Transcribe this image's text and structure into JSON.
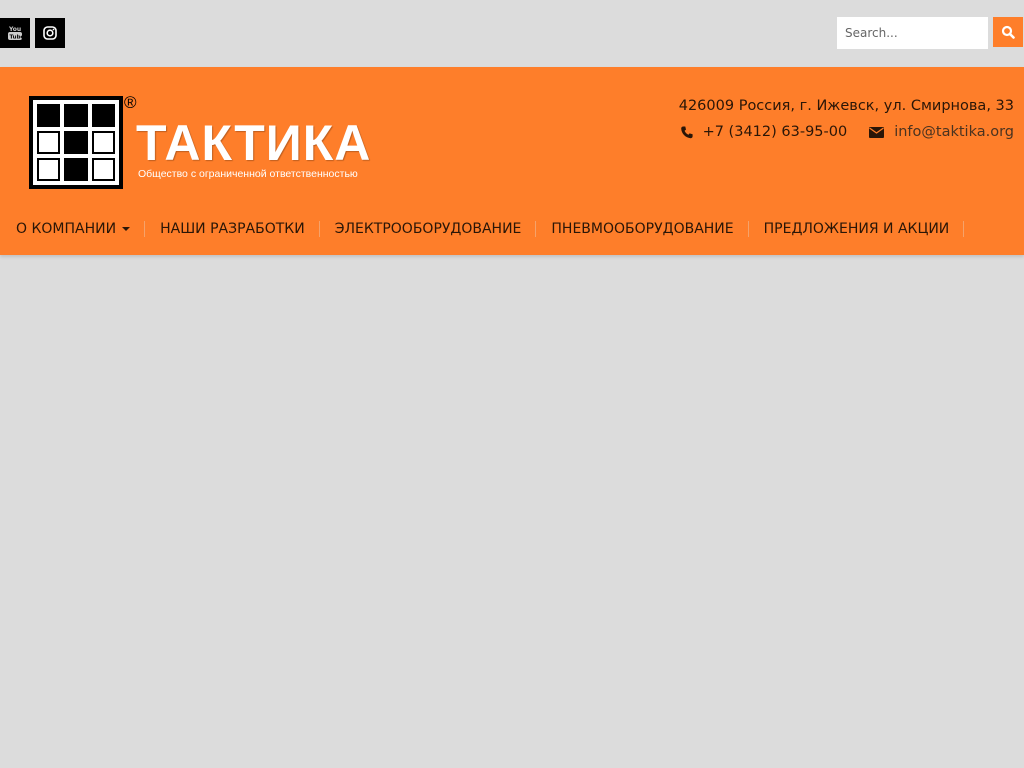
{
  "topbar": {
    "social": [
      {
        "name": "youtube",
        "icon": "youtube-icon",
        "label": "You Tube"
      },
      {
        "name": "instagram",
        "icon": "instagram-icon"
      }
    ],
    "search": {
      "placeholder": "Search...",
      "value": "",
      "button_icon": "search-icon"
    }
  },
  "header": {
    "logo": {
      "wordmark": "ТАКТИКА",
      "registered": "®",
      "subtitle": "Общество с ограниченной ответственностью"
    },
    "contact": {
      "address": "426009 Россия, г. Ижевск, ул. Смирнова, 33",
      "phone": "+7 (3412) 63-95-00",
      "phone_icon": "phone-icon",
      "email": "info@taktika.org",
      "email_icon": "envelope-icon"
    }
  },
  "nav": {
    "items": [
      {
        "label": "О КОМПАНИИ",
        "has_dropdown": true
      },
      {
        "label": "НАШИ РАЗРАБОТКИ"
      },
      {
        "label": "ЭЛЕКТРООБОРУДОВАНИЕ"
      },
      {
        "label": "ПНЕВМООБОРУДОВАНИЕ"
      },
      {
        "label": "ПРЕДЛОЖЕНИЯ И АКЦИИ"
      }
    ]
  },
  "colors": {
    "brand_orange": "#fe7e2a",
    "page_background": "#dcdcdc",
    "nav_text": "#2a1607"
  }
}
